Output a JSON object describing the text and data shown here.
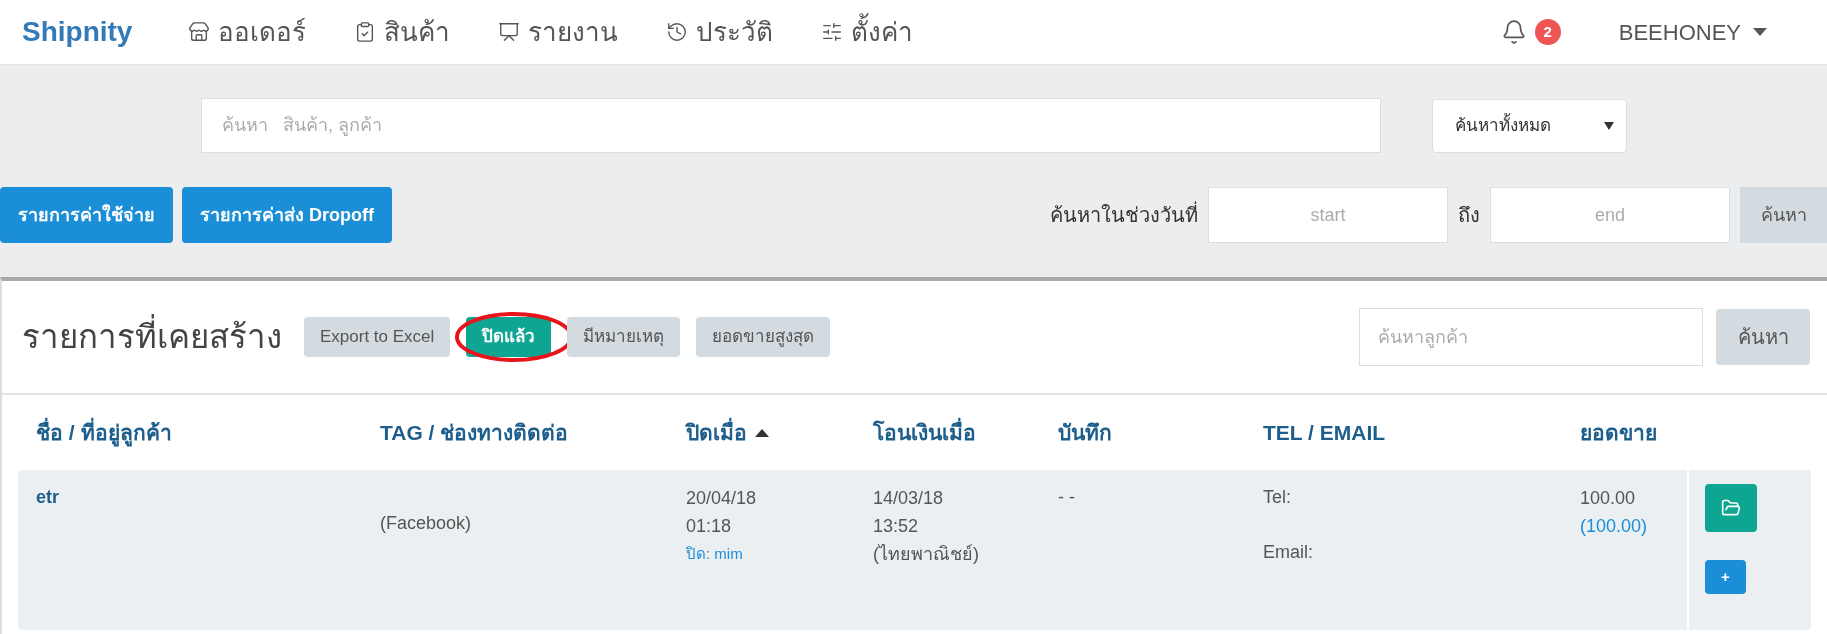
{
  "nav": {
    "brand": "Shipnity",
    "items": [
      {
        "kind": "store",
        "label": "ออเดอร์"
      },
      {
        "kind": "clipboard",
        "label": "สินค้า"
      },
      {
        "kind": "chart",
        "label": "รายงาน"
      },
      {
        "kind": "history",
        "label": "ประวัติ"
      },
      {
        "kind": "sliders",
        "label": "ตั้งค่า"
      }
    ],
    "notification_count": "2",
    "user": "BEEHONEY"
  },
  "search": {
    "placeholder": "ค้นหา   สินค้า, ลูกค้า",
    "scope": "ค้นหาทั้งหมด"
  },
  "actions": [
    "รายการค่าใช้จ่าย",
    "รายการค่าส่ง Dropoff"
  ],
  "date_range": {
    "label": "ค้นหาในช่วงวันที่",
    "start_placeholder": "start",
    "separator": "ถึง",
    "end_placeholder": "end",
    "button": "ค้นหา"
  },
  "list": {
    "title": "รายการที่เคยสร้าง",
    "filters": [
      {
        "label": "Export to Excel",
        "selected": false
      },
      {
        "label": "ปิดแล้ว",
        "selected": true
      },
      {
        "label": "มีหมายเหตุ",
        "selected": false
      },
      {
        "label": "ยอดขายสูงสุด",
        "selected": false
      }
    ],
    "customer_search_placeholder": "ค้นหาลูกค้า",
    "search_button": "ค้นหา"
  },
  "table": {
    "columns": [
      {
        "label": "ชื่อ / ที่อยู่ลูกค้า",
        "sorted": false
      },
      {
        "label": "TAG / ช่องทางติดต่อ",
        "sorted": false
      },
      {
        "label": "ปิดเมื่อ",
        "sorted": true
      },
      {
        "label": "โอนเงินเมื่อ",
        "sorted": false
      },
      {
        "label": "บันทึก",
        "sorted": false
      },
      {
        "label": "TEL / EMAIL",
        "sorted": false
      },
      {
        "label": "ยอดขาย",
        "sorted": false
      }
    ],
    "rows": [
      {
        "name": "etr",
        "tag": "(Facebook)",
        "closed_date": "20/04/18",
        "closed_time": "01:18",
        "closed_by": "ปิด: mim",
        "paid_date": "14/03/18",
        "paid_time": "13:52",
        "paid_bank": "(ไทยพาณิชย์)",
        "note": "- -",
        "tel": "Tel:",
        "email": "Email:",
        "total": "100.00",
        "paid_total": "(100.00)",
        "add_button": "+"
      }
    ]
  }
}
